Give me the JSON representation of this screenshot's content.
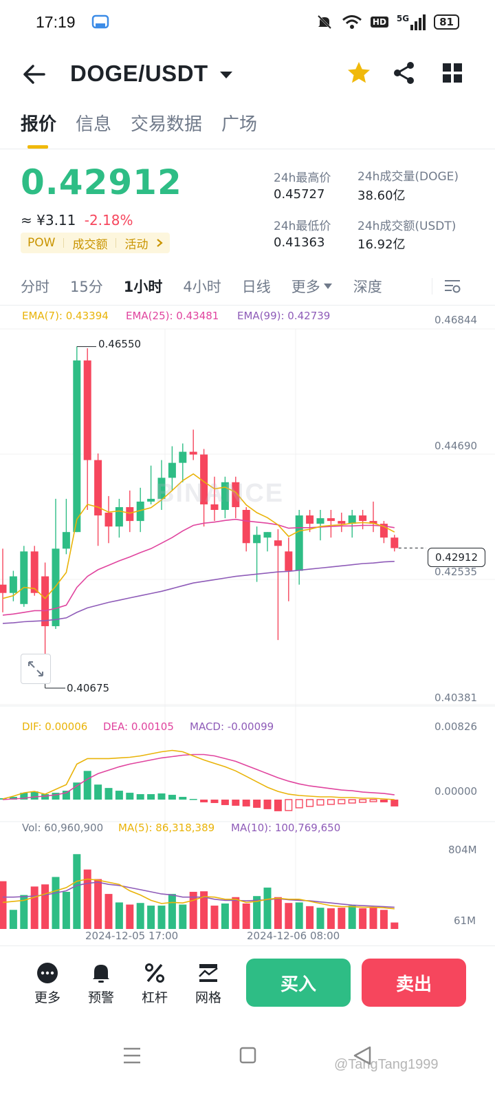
{
  "status": {
    "time": "17:19",
    "battery": "81",
    "network": "5G",
    "hd": "HD"
  },
  "header": {
    "pair": "DOGE/USDT"
  },
  "tabs": [
    {
      "label": "报价",
      "active": true
    },
    {
      "label": "信息",
      "active": false
    },
    {
      "label": "交易数据",
      "active": false
    },
    {
      "label": "广场",
      "active": false
    }
  ],
  "price": {
    "last": "0.42912",
    "cny": "≈ ¥3.11",
    "change": "-2.18%"
  },
  "tags": [
    "POW",
    "成交额",
    "活动"
  ],
  "stats": {
    "high_label": "24h最高价",
    "high_value": "0.45727",
    "low_label": "24h最低价",
    "low_value": "0.41363",
    "vol_label": "24h成交量(DOGE)",
    "vol_value": "38.60亿",
    "amount_label": "24h成交额(USDT)",
    "amount_value": "16.92亿"
  },
  "intervals": [
    {
      "label": "分时",
      "active": false
    },
    {
      "label": "15分",
      "active": false
    },
    {
      "label": "1小时",
      "active": true
    },
    {
      "label": "4小时",
      "active": false
    },
    {
      "label": "日线",
      "active": false
    },
    {
      "label": "更多",
      "active": false
    },
    {
      "label": "深度",
      "active": false
    }
  ],
  "legend": {
    "ema7": "EMA(7): 0.43394",
    "ema25": "EMA(25): 0.43481",
    "ema99": "EMA(99): 0.42739",
    "dif": "DIF: 0.00006",
    "dea": "DEA: 0.00105",
    "macd": "MACD: -0.00099",
    "vol": "Vol: 60,960,900",
    "ma5": "MA(5): 86,318,389",
    "ma10": "MA(10): 100,769,650"
  },
  "axes": {
    "price_ticks": [
      "0.46844",
      "0.44690",
      "0.42535",
      "0.40381"
    ],
    "macd_ticks": [
      "0.00826",
      "0.00000"
    ],
    "vol_ticks": [
      "804M",
      "61M"
    ],
    "time_ticks": [
      "2024-12-05 17:00",
      "2024-12-06 08:00"
    ],
    "high_marker": "0.46550",
    "low_marker": "0.40675",
    "current_price": "0.42912"
  },
  "watermark": "BINANCE",
  "bottom": {
    "more": "更多",
    "alert": "预警",
    "leverage": "杠杆",
    "grid": "网格",
    "buy": "买入",
    "sell": "卖出"
  },
  "credit": "@TangTang1999",
  "colors": {
    "up": "#2ebd85",
    "down": "#f6465d",
    "ema7": "#e9b308",
    "ema25": "#e0449e",
    "ema99": "#8e5bb8"
  },
  "chart_data": {
    "type": "candlestick",
    "price_range": [
      0.40381,
      0.46844
    ],
    "candles": [
      {
        "o": 0.4225,
        "h": 0.429,
        "l": 0.4175,
        "c": 0.421
      },
      {
        "o": 0.421,
        "h": 0.425,
        "l": 0.4195,
        "c": 0.424
      },
      {
        "o": 0.419,
        "h": 0.4295,
        "l": 0.4185,
        "c": 0.4285
      },
      {
        "o": 0.4285,
        "h": 0.4295,
        "l": 0.4205,
        "c": 0.421
      },
      {
        "o": 0.424,
        "h": 0.4265,
        "l": 0.406,
        "c": 0.415
      },
      {
        "o": 0.415,
        "h": 0.438,
        "l": 0.4145,
        "c": 0.429
      },
      {
        "o": 0.429,
        "h": 0.438,
        "l": 0.428,
        "c": 0.432
      },
      {
        "o": 0.432,
        "h": 0.4655,
        "l": 0.432,
        "c": 0.463
      },
      {
        "o": 0.463,
        "h": 0.4652,
        "l": 0.436,
        "c": 0.445
      },
      {
        "o": 0.445,
        "h": 0.4462,
        "l": 0.4295,
        "c": 0.435
      },
      {
        "o": 0.4355,
        "h": 0.4385,
        "l": 0.43,
        "c": 0.433
      },
      {
        "o": 0.433,
        "h": 0.438,
        "l": 0.431,
        "c": 0.4365
      },
      {
        "o": 0.4365,
        "h": 0.4395,
        "l": 0.432,
        "c": 0.434
      },
      {
        "o": 0.434,
        "h": 0.44,
        "l": 0.432,
        "c": 0.4375
      },
      {
        "o": 0.4375,
        "h": 0.444,
        "l": 0.437,
        "c": 0.438
      },
      {
        "o": 0.438,
        "h": 0.445,
        "l": 0.436,
        "c": 0.4418
      },
      {
        "o": 0.4418,
        "h": 0.4475,
        "l": 0.4395,
        "c": 0.4445
      },
      {
        "o": 0.4445,
        "h": 0.448,
        "l": 0.441,
        "c": 0.4465
      },
      {
        "o": 0.4465,
        "h": 0.4505,
        "l": 0.445,
        "c": 0.446
      },
      {
        "o": 0.446,
        "h": 0.447,
        "l": 0.433,
        "c": 0.437
      },
      {
        "o": 0.437,
        "h": 0.442,
        "l": 0.434,
        "c": 0.436
      },
      {
        "o": 0.436,
        "h": 0.442,
        "l": 0.4345,
        "c": 0.441
      },
      {
        "o": 0.441,
        "h": 0.442,
        "l": 0.4345,
        "c": 0.4365
      },
      {
        "o": 0.436,
        "h": 0.4365,
        "l": 0.4285,
        "c": 0.43
      },
      {
        "o": 0.43,
        "h": 0.433,
        "l": 0.423,
        "c": 0.4315
      },
      {
        "o": 0.431,
        "h": 0.432,
        "l": 0.4285,
        "c": 0.432
      },
      {
        "o": 0.4305,
        "h": 0.4325,
        "l": 0.4125,
        "c": 0.4295
      },
      {
        "o": 0.4285,
        "h": 0.431,
        "l": 0.4195,
        "c": 0.425
      },
      {
        "o": 0.425,
        "h": 0.436,
        "l": 0.4225,
        "c": 0.435
      },
      {
        "o": 0.435,
        "h": 0.436,
        "l": 0.432,
        "c": 0.4335
      },
      {
        "o": 0.4335,
        "h": 0.436,
        "l": 0.4305,
        "c": 0.4345
      },
      {
        "o": 0.4345,
        "h": 0.436,
        "l": 0.431,
        "c": 0.434
      },
      {
        "o": 0.434,
        "h": 0.4355,
        "l": 0.432,
        "c": 0.4335
      },
      {
        "o": 0.4335,
        "h": 0.436,
        "l": 0.431,
        "c": 0.435
      },
      {
        "o": 0.435,
        "h": 0.436,
        "l": 0.4325,
        "c": 0.434
      },
      {
        "o": 0.434,
        "h": 0.4375,
        "l": 0.432,
        "c": 0.4335
      },
      {
        "o": 0.4335,
        "h": 0.434,
        "l": 0.43,
        "c": 0.431
      },
      {
        "o": 0.431,
        "h": 0.4315,
        "l": 0.4285,
        "c": 0.4291
      }
    ],
    "ema7": [
      0.42,
      0.4205,
      0.422,
      0.4218,
      0.42,
      0.4222,
      0.4247,
      0.4343,
      0.437,
      0.4365,
      0.4356,
      0.4358,
      0.4354,
      0.4359,
      0.4364,
      0.4378,
      0.4395,
      0.4413,
      0.4425,
      0.4411,
      0.4398,
      0.4401,
      0.4392,
      0.4369,
      0.4355,
      0.4346,
      0.4333,
      0.4312,
      0.4322,
      0.4325,
      0.433,
      0.4332,
      0.4333,
      0.4336,
      0.4337,
      0.4336,
      0.433,
      0.432
    ],
    "ema25": [
      0.417,
      0.4172,
      0.4175,
      0.4178,
      0.4178,
      0.4182,
      0.4188,
      0.422,
      0.424,
      0.4252,
      0.426,
      0.4268,
      0.4275,
      0.4283,
      0.429,
      0.43,
      0.431,
      0.4322,
      0.4332,
      0.4336,
      0.4338,
      0.4341,
      0.4343,
      0.434,
      0.4338,
      0.4336,
      0.4333,
      0.4327,
      0.4328,
      0.4328,
      0.4329,
      0.433,
      0.4331,
      0.4331,
      0.4332,
      0.4332,
      0.4331,
      0.4328
    ],
    "ema99": [
      0.4155,
      0.4156,
      0.4158,
      0.4159,
      0.416,
      0.4162,
      0.4165,
      0.4175,
      0.4183,
      0.4188,
      0.4193,
      0.4197,
      0.4201,
      0.4205,
      0.4209,
      0.4213,
      0.4218,
      0.4223,
      0.4228,
      0.4231,
      0.4234,
      0.4237,
      0.424,
      0.4242,
      0.4244,
      0.4246,
      0.4248,
      0.4249,
      0.4251,
      0.4253,
      0.4255,
      0.4257,
      0.4259,
      0.4261,
      0.4263,
      0.4264,
      0.4266,
      0.4267
    ],
    "macd_range": [
      -0.0015,
      0.00826
    ],
    "macd_hist": [
      0.0002,
      0.0004,
      0.001,
      0.0012,
      0.0008,
      0.001,
      0.0013,
      0.0025,
      0.0042,
      0.0022,
      0.0017,
      0.0013,
      0.001,
      0.0008,
      0.0008,
      0.0009,
      0.0007,
      0.0004,
      0.0001,
      -0.0004,
      -0.0005,
      -0.0008,
      -0.0009,
      -0.001,
      -0.0012,
      -0.0014,
      -0.0017,
      -0.0016,
      -0.0012,
      -0.001,
      -0.0008,
      -0.0007,
      -0.0006,
      -0.0005,
      -0.0004,
      -0.0003,
      -0.0004,
      -0.001
    ],
    "dif": [
      0.0001,
      0.0005,
      0.001,
      0.0012,
      0.0008,
      0.0015,
      0.0022,
      0.0052,
      0.006,
      0.006,
      0.006,
      0.0061,
      0.0062,
      0.0064,
      0.0067,
      0.007,
      0.0072,
      0.007,
      0.0064,
      0.0058,
      0.0053,
      0.0048,
      0.0042,
      0.0034,
      0.0026,
      0.0018,
      0.0012,
      0.0008,
      0.0006,
      0.0005,
      0.0004,
      0.0004,
      0.0003,
      0.0003,
      0.0002,
      0.0002,
      0.0001,
      0.0
    ],
    "dea": [
      0.0,
      0.0001,
      0.0002,
      0.0004,
      0.0005,
      0.0007,
      0.001,
      0.002,
      0.003,
      0.0038,
      0.0043,
      0.0048,
      0.0052,
      0.0055,
      0.0058,
      0.0061,
      0.0063,
      0.0065,
      0.0066,
      0.0066,
      0.0064,
      0.006,
      0.0056,
      0.005,
      0.0044,
      0.0038,
      0.0032,
      0.0027,
      0.0023,
      0.002,
      0.0018,
      0.0016,
      0.0014,
      0.0013,
      0.0011,
      0.001,
      0.0009,
      0.0007
    ],
    "vol_range": [
      0,
      804
    ],
    "volume": [
      450,
      180,
      320,
      400,
      420,
      490,
      350,
      705,
      560,
      470,
      330,
      250,
      230,
      245,
      220,
      220,
      330,
      230,
      350,
      355,
      220,
      240,
      300,
      240,
      310,
      390,
      300,
      245,
      250,
      215,
      200,
      195,
      200,
      220,
      195,
      200,
      180,
      61
    ],
    "ma5": [
      250,
      260,
      270,
      300,
      330,
      360,
      390,
      450,
      470,
      460,
      440,
      420,
      360,
      320,
      270,
      240,
      250,
      245,
      270,
      305,
      300,
      280,
      280,
      250,
      260,
      280,
      290,
      280,
      280,
      260,
      240,
      220,
      210,
      210,
      205,
      205,
      200,
      190
    ],
    "ma10": [
      300,
      300,
      305,
      310,
      320,
      340,
      360,
      410,
      430,
      440,
      420,
      410,
      390,
      370,
      350,
      330,
      320,
      300,
      300,
      300,
      280,
      270,
      270,
      265,
      270,
      275,
      285,
      275,
      270,
      265,
      255,
      245,
      235,
      225,
      220,
      215,
      210,
      205
    ]
  }
}
